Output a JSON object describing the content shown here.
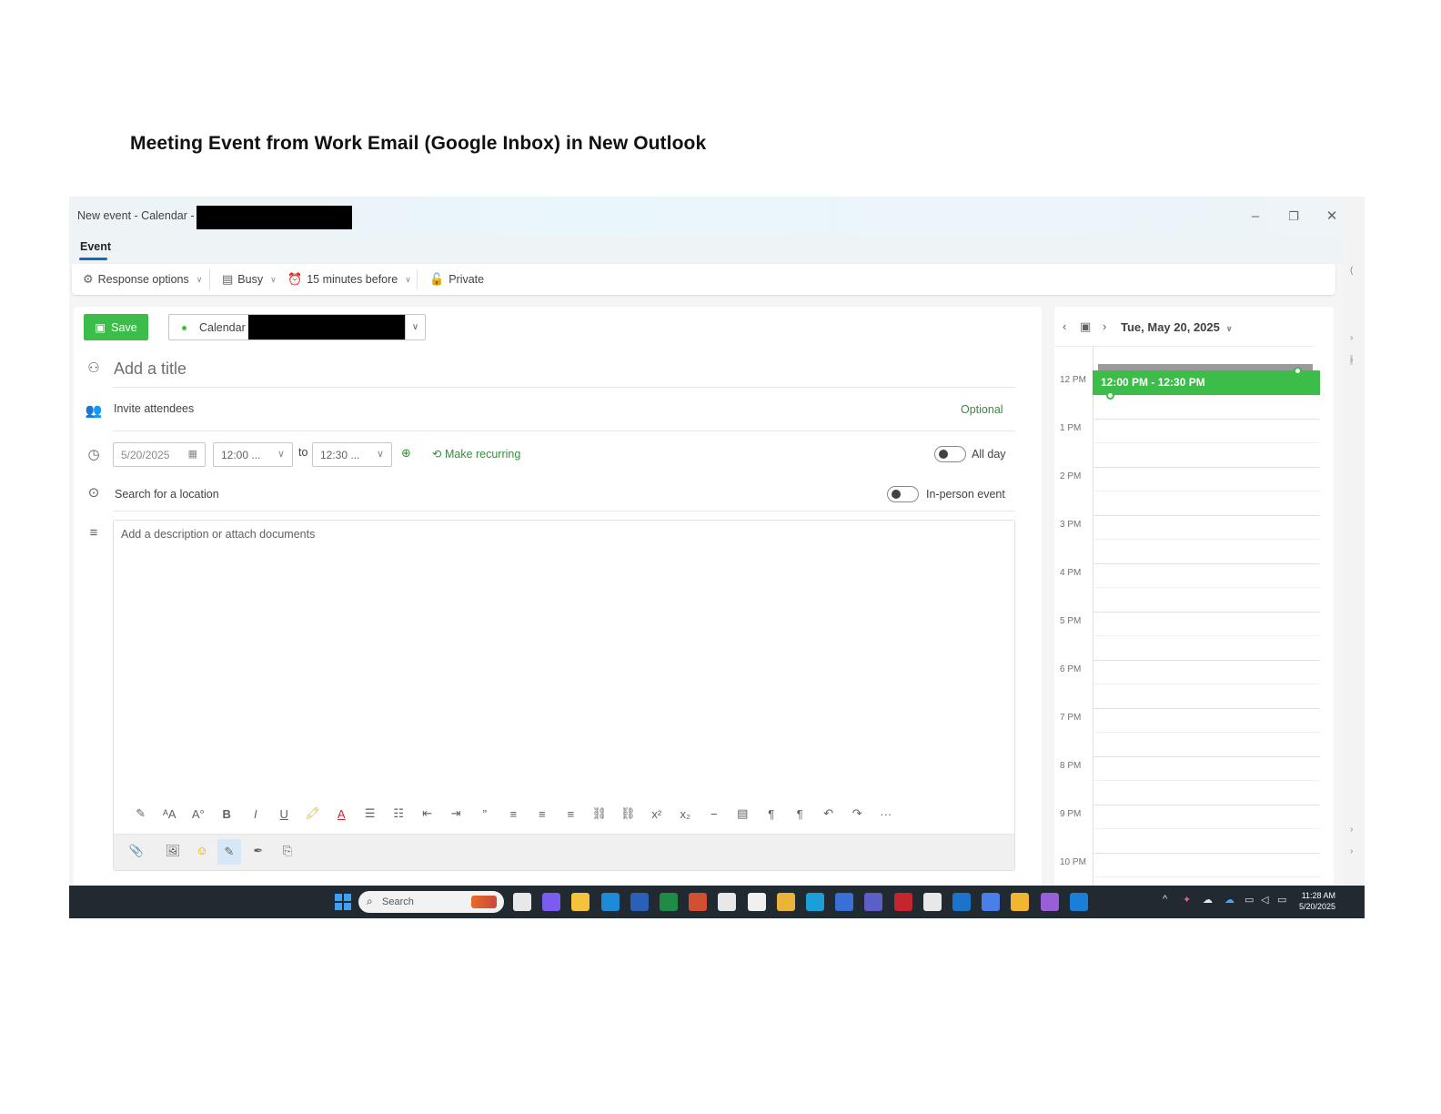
{
  "doc_title": "Meeting  Event from Work Email (Google Inbox) in New Outlook",
  "window": {
    "title": "New event - Calendar -",
    "controls": {
      "minimize": "–",
      "restore": "❐",
      "close": "✕"
    }
  },
  "tabs": {
    "event": "Event"
  },
  "ribbon": {
    "response_options": "Response options",
    "busy": "Busy",
    "reminder": "15 minutes before",
    "private": "Private"
  },
  "form": {
    "save_label": "Save",
    "calendar_label": "Calendar",
    "title_placeholder": "Add a title",
    "attendees_placeholder": "Invite attendees",
    "optional_label": "Optional",
    "date_value": "5/20/2025",
    "start_time": "12:00 ...",
    "to_label": "to",
    "end_time": "12:30 ...",
    "make_recurring": "Make recurring",
    "all_day_label": "All day",
    "location_placeholder": "Search for a location",
    "in_person_label": "In-person event",
    "description_placeholder": "Add a description or attach documents"
  },
  "format_toolbar": [
    "✎",
    "ᴬA",
    "A°",
    "B",
    "I",
    "U",
    "🖍",
    "A",
    "☰",
    "☷",
    "⇤",
    "⇥",
    "”",
    "≡",
    "≡",
    "≡",
    "⛓",
    "⛓",
    "x²",
    "x₂",
    "⎯",
    "▤",
    "¶",
    "¶",
    "↶",
    "↷",
    "···"
  ],
  "insert_toolbar": [
    "📎",
    "🖼",
    "☺",
    "✎",
    "✒",
    "⎘"
  ],
  "calendar_pane": {
    "date_label": "Tue, May 20, 2025",
    "event_label": "12:00 PM - 12:30 PM",
    "hours": [
      "12 PM",
      "1 PM",
      "2 PM",
      "3 PM",
      "4 PM",
      "5 PM",
      "6 PM",
      "7 PM",
      "8 PM",
      "9 PM",
      "10 PM"
    ]
  },
  "taskbar": {
    "search_label": "Search",
    "time": "11:28 AM",
    "date": "5/20/2025",
    "app_colors": [
      "#e8e8e8",
      "#7b5cf0",
      "#f5c23b",
      "#1f8ad8",
      "#2b5fb8",
      "#1e8c45",
      "#d2502f",
      "#e8e8e8",
      "#f0f0f0",
      "#e9b43a",
      "#1a9fd6",
      "#3b6fd8",
      "#5b5fc7",
      "#c4262e",
      "#e8e8e8",
      "#1c74c9",
      "#4a7ee8",
      "#f2b530",
      "#9a5fd8",
      "#1a7fd6"
    ],
    "accent": "#3cbd4a"
  }
}
